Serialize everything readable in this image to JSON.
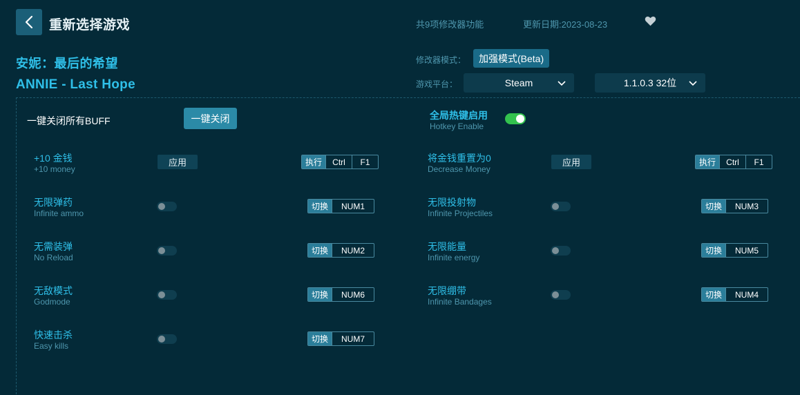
{
  "header": {
    "title": "重新选择游戏",
    "feature_count": "共9项修改器功能",
    "update_date": "更新日期:2023-08-23"
  },
  "game": {
    "name_cn": "安妮：最后的希望",
    "name_en": "ANNIE - Last Hope"
  },
  "settings": {
    "mode_label": "修改器模式：",
    "mode_value": "加强模式(Beta)",
    "platform_label": "游戏平台：",
    "platform_value": "Steam",
    "version_value": "1.1.0.3 32位"
  },
  "global": {
    "kill_all_label": "一键关闭所有BUFF",
    "kill_all_button": "一键关闭",
    "hotkey_cn": "全局热键启用",
    "hotkey_en": "Hotkey Enable",
    "hotkey_enabled": true
  },
  "options_left": [
    {
      "cn": "+10 金钱",
      "en": "+10 money",
      "control": "apply",
      "control_label": "应用",
      "action": "执行",
      "keys": [
        "Ctrl",
        "F1"
      ]
    },
    {
      "cn": "无限弹药",
      "en": "Infinite ammo",
      "control": "toggle",
      "enabled": false,
      "action": "切换",
      "keys": [
        "NUM1"
      ]
    },
    {
      "cn": "无需装弹",
      "en": "No Reload",
      "control": "toggle",
      "enabled": false,
      "action": "切换",
      "keys": [
        "NUM2"
      ]
    },
    {
      "cn": "无敌模式",
      "en": "Godmode",
      "control": "toggle",
      "enabled": false,
      "action": "切换",
      "keys": [
        "NUM6"
      ]
    },
    {
      "cn": "快速击杀",
      "en": "Easy kills",
      "control": "toggle",
      "enabled": false,
      "action": "切换",
      "keys": [
        "NUM7"
      ]
    }
  ],
  "options_right": [
    {
      "cn": "将金钱重置为0",
      "en": "Decrease Money",
      "control": "apply",
      "control_label": "应用",
      "action": "执行",
      "keys": [
        "Ctrl",
        "F1"
      ]
    },
    {
      "cn": "无限投射物",
      "en": "Infinite Projectiles",
      "control": "toggle",
      "enabled": false,
      "action": "切换",
      "keys": [
        "NUM3"
      ]
    },
    {
      "cn": "无限能量",
      "en": "Infinite energy",
      "control": "toggle",
      "enabled": false,
      "action": "切换",
      "keys": [
        "NUM5"
      ]
    },
    {
      "cn": "无限绷带",
      "en": "Infinite Bandages",
      "control": "toggle",
      "enabled": false,
      "action": "切换",
      "keys": [
        "NUM4"
      ]
    }
  ],
  "icons": {
    "back": "chevron-left-icon",
    "favorite": "heart-icon",
    "dropdown": "chevron-down-icon"
  },
  "colors": {
    "background": "#042a38",
    "accent": "#2fbfe8",
    "toggle_on": "#33c24e"
  }
}
